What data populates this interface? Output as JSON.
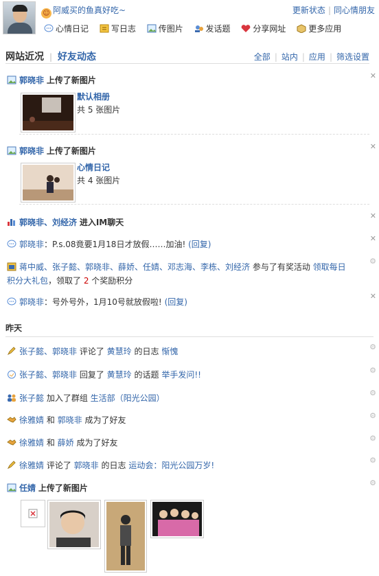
{
  "header": {
    "status_text": "阿威买的鱼真好吃~",
    "update_status": "更新状态",
    "same_mood": "同心情朋友",
    "actions": [
      {
        "label": "心情日记",
        "icon": "mood-diary-icon"
      },
      {
        "label": "写日志",
        "icon": "write-blog-icon"
      },
      {
        "label": "传图片",
        "icon": "upload-photo-icon"
      },
      {
        "label": "发话题",
        "icon": "post-topic-icon"
      },
      {
        "label": "分享网址",
        "icon": "share-url-icon"
      },
      {
        "label": "更多应用",
        "icon": "more-apps-icon"
      }
    ]
  },
  "tabs": {
    "recent": "网站近况",
    "friends": "好友动态",
    "filters": [
      "全部",
      "站内",
      "应用",
      "筛选设置"
    ]
  },
  "feed": {
    "item1": {
      "user": "郭晓非",
      "action": "上传了新图片",
      "album": "默认相册",
      "count": "共 5 张图片"
    },
    "item2": {
      "user": "郭晓非",
      "action": "上传了新图片",
      "album": "心情日记",
      "count": "共 4 张图片"
    },
    "item3": {
      "users": "郭晓非、刘经济",
      "action": "进入IM聊天"
    },
    "item4": {
      "user": "郭晓非",
      "text": "：P.s.08竟要1月18日才放假……加油!",
      "reply": "(回复)"
    },
    "item5": {
      "users": "蒋中威、张子懿、郭晓非、薛娇、任婧、邓志海、李栋、刘经济",
      "mid": " 参与了有奖活动 ",
      "activity": "领取每日",
      "activity2": "积分大礼包",
      "tail1": "，领取了 ",
      "points": "2",
      "tail2": " 个奖励积分"
    },
    "item6": {
      "user": "郭晓非",
      "text": "：号外号外，1月10号就放假啦!",
      "reply": "(回复)"
    }
  },
  "yesterday": {
    "heading": "昨天",
    "items": [
      {
        "a": "张子懿、郭晓非",
        "b": " 评论了 ",
        "c": "黄慧玲",
        "d": " 的日志 ",
        "e": "惭愧",
        "icon": "comment-icon"
      },
      {
        "a": "张子懿、郭晓非",
        "b": " 回复了 ",
        "c": "黄慧玲",
        "d": " 的话题 ",
        "e": "举手发问!!",
        "icon": "reply-icon"
      },
      {
        "a": "张子懿",
        "b": " 加入了群组 ",
        "c": "生活部",
        "d": "（阳光公园）",
        "e": "",
        "icon": "group-icon"
      },
      {
        "a": "徐雅婧",
        "b": " 和 ",
        "c": "郭晓非",
        "d": " 成为了好友",
        "e": "",
        "icon": "friend-icon"
      },
      {
        "a": "徐雅婧",
        "b": " 和 ",
        "c": "薛娇",
        "d": " 成为了好友",
        "e": "",
        "icon": "friend-icon"
      },
      {
        "a": "徐雅婧",
        "b": " 评论了 ",
        "c": "郭晓非",
        "d": " 的日志 ",
        "e": "运动会：阳光公园万岁!",
        "icon": "comment-icon"
      }
    ],
    "last": {
      "user": "任婧",
      "action": "上传了新图片"
    }
  }
}
